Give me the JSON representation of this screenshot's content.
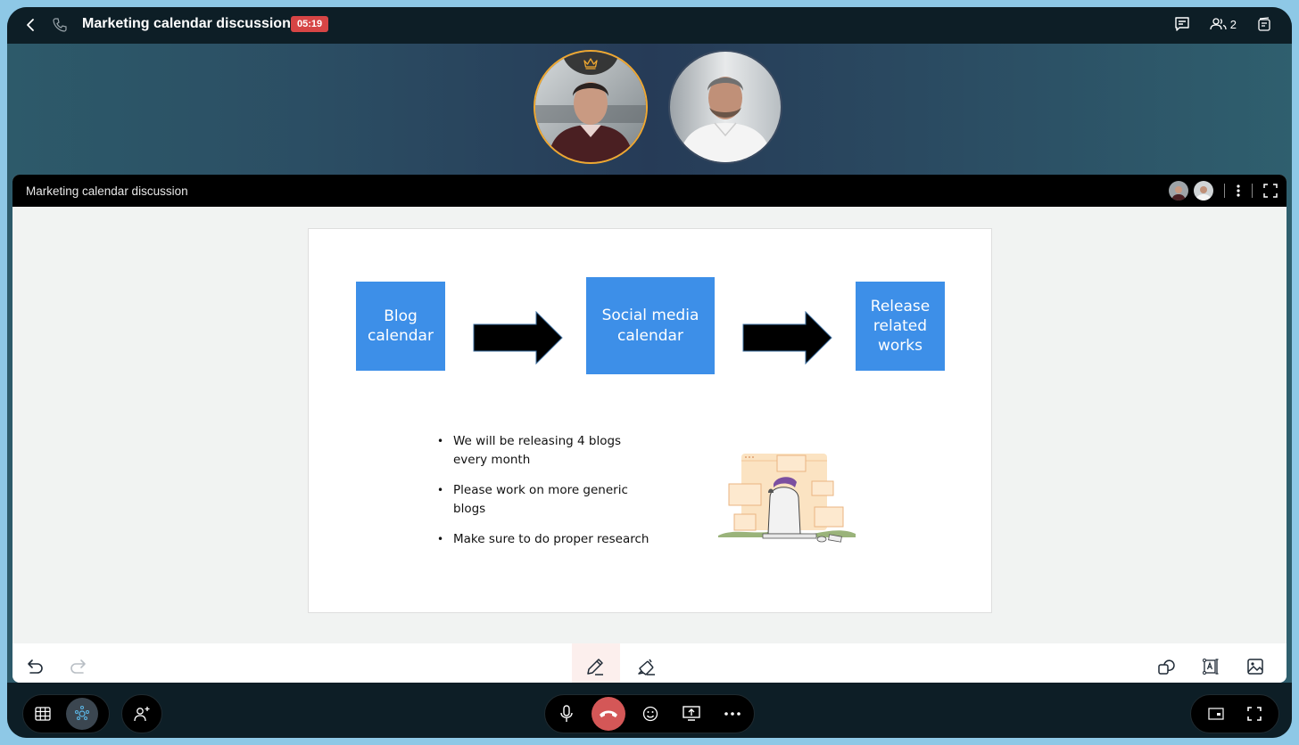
{
  "topbar": {
    "title": "Marketing calendar discussion",
    "timer": "05:19",
    "participant_count": "2",
    "icons": [
      "back-icon",
      "phone-icon",
      "chat-icon",
      "participants-icon",
      "notes-icon"
    ]
  },
  "participants": [
    {
      "name": "host-participant",
      "is_host": true,
      "ring_color": "#f0a830"
    },
    {
      "name": "participant-2",
      "is_host": false
    }
  ],
  "panel": {
    "title": "Marketing calendar discussion",
    "icons": [
      "more-icon",
      "fullscreen-icon"
    ]
  },
  "slide": {
    "boxes": [
      "Blog calendar",
      "Social media calendar",
      "Release related works"
    ],
    "box_color": "#3d8fe8",
    "bullets": [
      "We will be releasing 4 blogs every month",
      "Please work on more generic blogs",
      "Make sure to do proper research"
    ]
  },
  "drawbar": {
    "left_tools": [
      "undo-icon",
      "redo-icon"
    ],
    "center_tools": [
      {
        "name": "pen-icon",
        "active": true
      },
      {
        "name": "highlighter-icon",
        "active": false
      }
    ],
    "right_tools": [
      "shapes-icon",
      "text-box-icon",
      "image-icon"
    ],
    "accent": "#e05050"
  },
  "controlbar": {
    "left": [
      {
        "name": "grid-view-icon",
        "active": false
      },
      {
        "name": "whiteboard-icon",
        "active": true
      },
      {
        "name": "add-participant-icon"
      }
    ],
    "center": [
      "microphone-icon",
      "end-call-icon",
      "emoji-icon",
      "share-screen-icon",
      "more-options-icon"
    ],
    "right": [
      "picture-in-picture-icon",
      "fullscreen-icon"
    ],
    "end_call_color": "#d45757"
  }
}
